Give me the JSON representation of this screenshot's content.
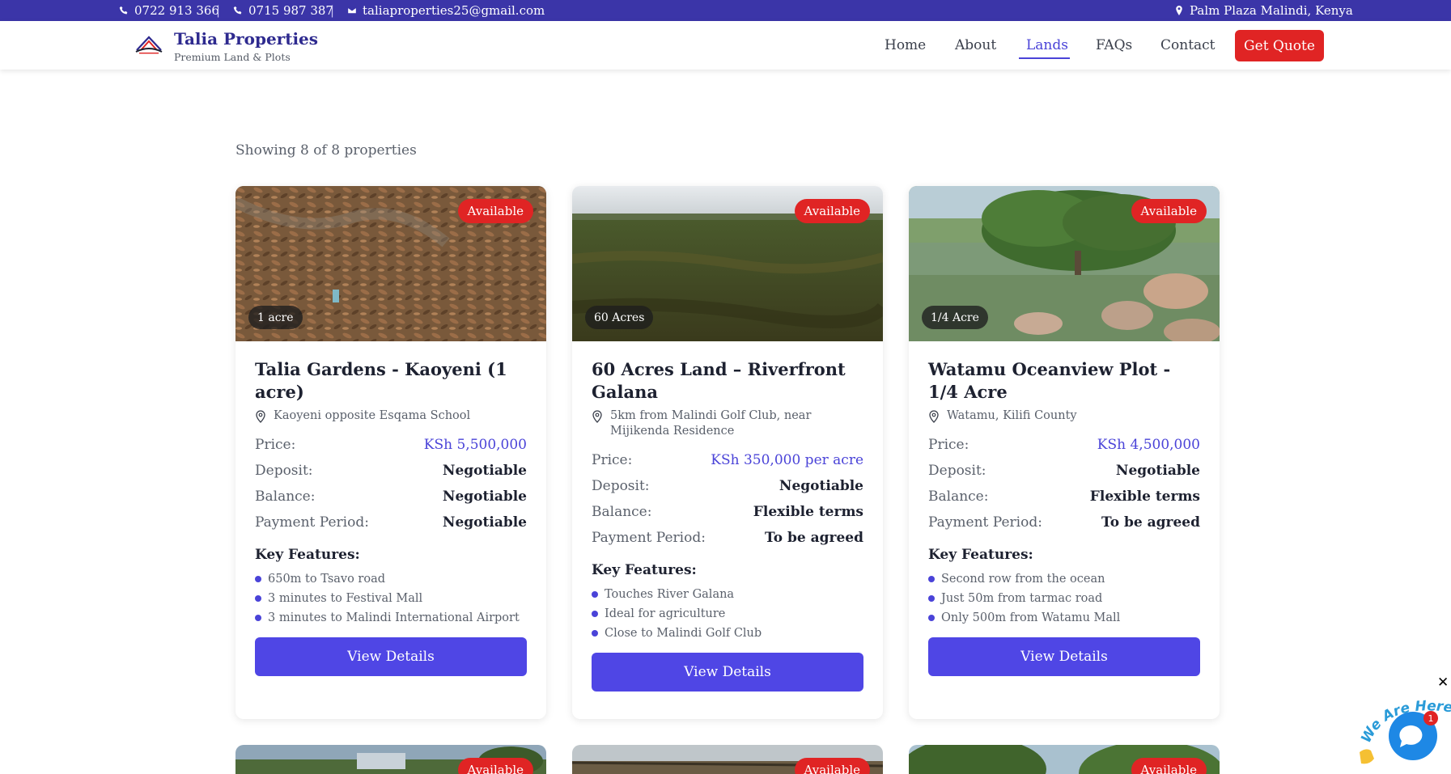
{
  "topbar": {
    "phone1": "0722 913 366",
    "phone2": "0715 987 387",
    "email": "taliaproperties25@gmail.com",
    "address": "Palm Plaza Malindi, Kenya",
    "separator": "|"
  },
  "brand": {
    "title": "Talia Properties",
    "subtitle": "Premium Land & Plots"
  },
  "nav": {
    "items": [
      "Home",
      "About",
      "Lands",
      "FAQs",
      "Contact"
    ],
    "active": "Lands",
    "quote": "Get Quote"
  },
  "listing": {
    "showing": "Showing 8 of 8 properties"
  },
  "labels": {
    "price": "Price:",
    "deposit": "Deposit:",
    "balance": "Balance:",
    "payment_period": "Payment Period:",
    "key_features": "Key Features:",
    "view_details": "View Details"
  },
  "cards": [
    {
      "badge": "Available",
      "size": "1 acre",
      "title": "Talia Gardens - Kaoyeni (1 acre)",
      "location": "Kaoyeni opposite Esqama School",
      "price": "KSh 5,500,000",
      "deposit": "Negotiable",
      "balance": "Negotiable",
      "payment_period": "Negotiable",
      "features": [
        "650m to Tsavo road",
        "3 minutes to Festival Mall",
        "3 minutes to Malindi International Airport"
      ]
    },
    {
      "badge": "Available",
      "size": "60 Acres",
      "title": "60 Acres Land – Riverfront Galana",
      "location": "5km from Malindi Golf Club, near Mijikenda Residence",
      "price": "KSh 350,000 per acre",
      "deposit": "Negotiable",
      "balance": "Flexible terms",
      "payment_period": "To be agreed",
      "features": [
        "Touches River Galana",
        "Ideal for agriculture",
        "Close to Malindi Golf Club"
      ]
    },
    {
      "badge": "Available",
      "size": "1/4 Acre",
      "title": "Watamu Oceanview Plot - 1/4 Acre",
      "location": "Watamu, Kilifi County",
      "price": "KSh 4,500,000",
      "deposit": "Negotiable",
      "balance": "Flexible terms",
      "payment_period": "To be agreed",
      "features": [
        "Second row from the ocean",
        "Just 50m from tarmac road",
        "Only 500m from Watamu Mall"
      ]
    }
  ],
  "more_cards": [
    {
      "badge": "Available"
    },
    {
      "badge": "Available"
    },
    {
      "badge": "Available"
    }
  ],
  "chat": {
    "tagline": "We Are Here!",
    "unread": "1",
    "close": "✕"
  },
  "colors": {
    "topbar": "#3b35a8",
    "primary": "#4f46e5",
    "accent_red": "#e02424",
    "price": "#4a43d8"
  }
}
